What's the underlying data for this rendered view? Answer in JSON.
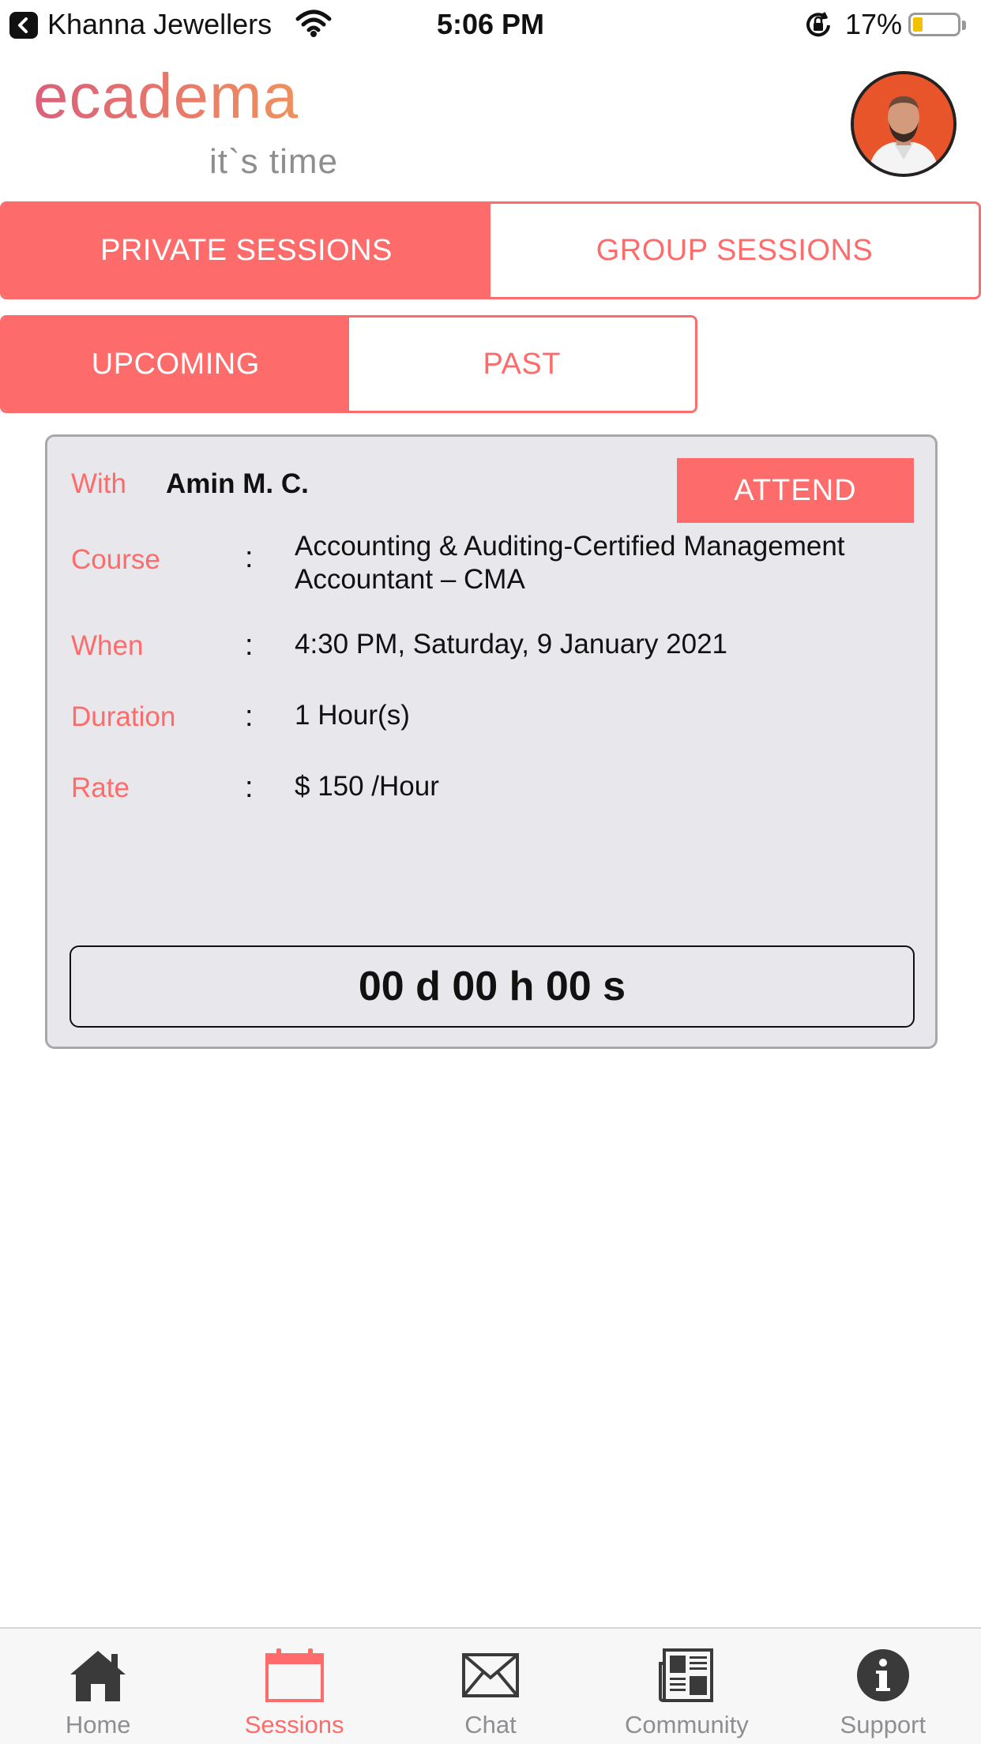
{
  "status_bar": {
    "carrier": "Khanna Jewellers",
    "time": "5:06 PM",
    "battery": "17%",
    "battery_level": 0.17
  },
  "header": {
    "logo_text": "ecadema",
    "tagline": "it`s time"
  },
  "session_type_tabs": [
    {
      "label": "PRIVATE SESSIONS",
      "active": true
    },
    {
      "label": "GROUP SESSIONS",
      "active": false
    }
  ],
  "time_filter_tabs": [
    {
      "label": "UPCOMING",
      "active": true
    },
    {
      "label": "PAST",
      "active": false
    }
  ],
  "session": {
    "with_label": "With",
    "with_value": "Amin M. C.",
    "attend_label": "ATTEND",
    "course_label": "Course",
    "course_value_line1": "Accounting & Auditing-Certified Management",
    "course_value_line2": "Accountant – CMA",
    "when_label": "When",
    "when_value": "4:30 PM, Saturday, 9 January 2021",
    "duration_label": "Duration",
    "duration_value": "1 Hour(s)",
    "rate_label": "Rate",
    "rate_value": "$ 150 /Hour",
    "separator": ":",
    "countdown": "00 d 00 h 00 s"
  },
  "colors": {
    "accent": "#fe6b6b",
    "card_bg": "#e8e8ec",
    "tab_inactive": "#8e8e93"
  },
  "tabbar": [
    {
      "label": "Home",
      "icon": "home-icon",
      "active": false
    },
    {
      "label": "Sessions",
      "icon": "calendar-icon",
      "active": true
    },
    {
      "label": "Chat",
      "icon": "envelope-icon",
      "active": false
    },
    {
      "label": "Community",
      "icon": "newspaper-icon",
      "active": false
    },
    {
      "label": "Support",
      "icon": "info-icon",
      "active": false
    }
  ]
}
